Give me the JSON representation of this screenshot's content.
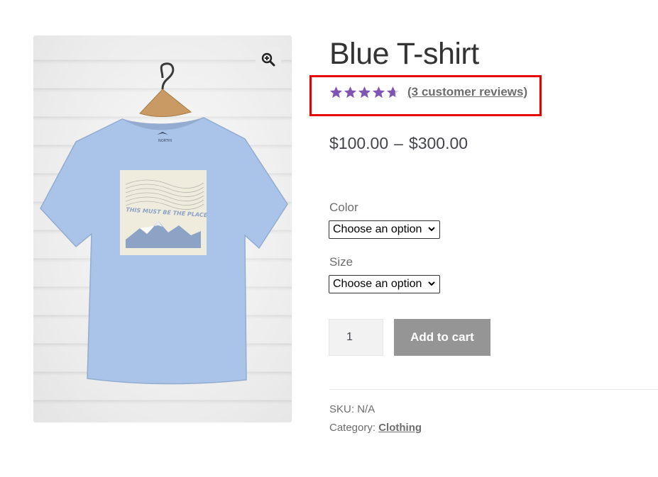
{
  "product": {
    "title": "Blue T-shirt",
    "rating": 4.67,
    "reviews_link": "(3 customer reviews)",
    "price_min": "$100.00",
    "price_separator": "–",
    "price_max": "$300.00",
    "image_print_text": "THIS MUST BE THE PLACE",
    "image_tag_text": "NORTHI"
  },
  "icons": {
    "zoom": "magnifier-plus-icon",
    "star": "star-icon",
    "select_chevron": "chevron-down-icon"
  },
  "variations": {
    "color": {
      "label": "Color",
      "selected": "Choose an option"
    },
    "size": {
      "label": "Size",
      "selected": "Choose an option"
    }
  },
  "cart": {
    "quantity": "1",
    "add_to_cart_label": "Add to cart"
  },
  "meta": {
    "sku_label": "SKU:",
    "sku_value": "N/A",
    "category_label": "Category:",
    "category_value": "Clothing"
  },
  "colors": {
    "star": "#7f54b3",
    "highlight_border": "#e60000",
    "button": "#959595",
    "shirt": "#a9c4e8"
  }
}
